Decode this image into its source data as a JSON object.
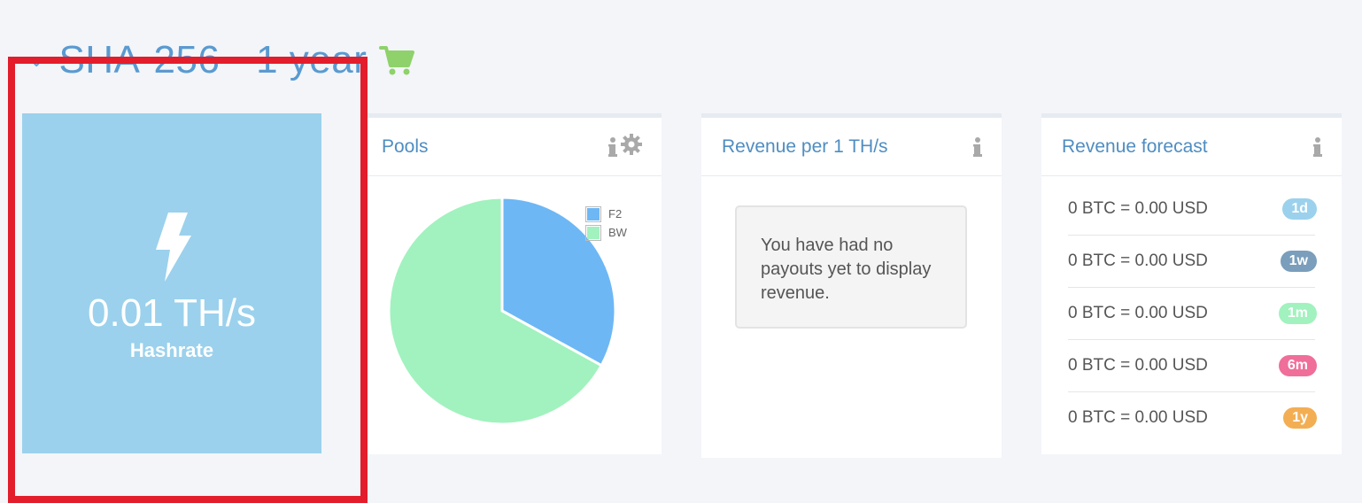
{
  "heading": {
    "title": "SHA-256 - 1 year",
    "chevron_icon": "chevron-down-icon",
    "cart_icon": "shopping-cart-icon",
    "cart_color": "#8fd16a"
  },
  "hashrate_tile": {
    "value": "0.01 TH/s",
    "label": "Hashrate",
    "icon": "lightning-bolt-icon",
    "background": "#9bd1ec"
  },
  "pools_panel": {
    "title": "Pools",
    "icons": [
      "info-icon",
      "gear-icon"
    ],
    "chart_data": {
      "type": "pie",
      "series": [
        {
          "name": "F2",
          "value": 33,
          "color": "#6db7f5"
        },
        {
          "name": "BW",
          "value": 67,
          "color": "#a1f2be"
        }
      ],
      "legend_position": "top-right"
    }
  },
  "revenue_panel": {
    "title": "Revenue per 1 TH/s",
    "icons": [
      "info-icon"
    ],
    "message": "You have had no payouts yet to display revenue."
  },
  "forecast_panel": {
    "title": "Revenue forecast",
    "icons": [
      "info-icon"
    ],
    "rows": [
      {
        "text": "0 BTC = 0.00 USD",
        "badge": "1d",
        "color": "#9bd1ec"
      },
      {
        "text": "0 BTC = 0.00 USD",
        "badge": "1w",
        "color": "#7a9ebb"
      },
      {
        "text": "0 BTC = 0.00 USD",
        "badge": "1m",
        "color": "#a1f2be"
      },
      {
        "text": "0 BTC = 0.00 USD",
        "badge": "6m",
        "color": "#f06e9a"
      },
      {
        "text": "0 BTC = 0.00 USD",
        "badge": "1y",
        "color": "#f3ae54"
      }
    ]
  },
  "highlight_color": "#e31d2b"
}
